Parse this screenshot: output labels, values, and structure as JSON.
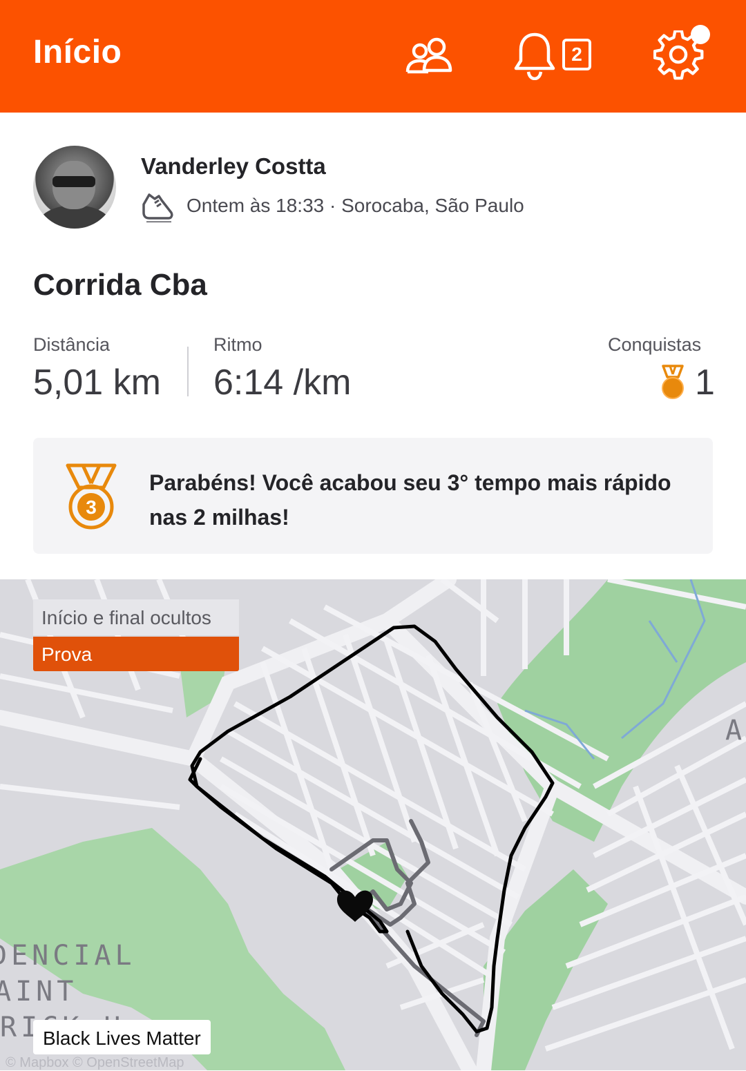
{
  "header": {
    "title": "Início",
    "notification_count": "2",
    "accent_color": "#fc5200",
    "icons": [
      "people-icon",
      "bell-icon",
      "gear-icon"
    ]
  },
  "activity": {
    "athlete_name": "Vanderley Costta",
    "sport_icon": "running-shoe-icon",
    "meta": "Ontem às 18:33 · Sorocaba, São Paulo",
    "title": "Corrida Cba",
    "stats": {
      "distance_label": "Distância",
      "distance_value": "5,01 km",
      "pace_label": "Ritmo",
      "pace_value": "6:14 /km",
      "achievements_label": "Conquistas",
      "achievements_value": "1"
    },
    "achievement_message": "Parabéns! Você acabou seu 3° tempo mais rápido nas 2 milhas!",
    "medal_number": "3",
    "medal_color": "#e8890c"
  },
  "map": {
    "tag_hidden": "Início e final ocultos",
    "tag_race": "Prova",
    "badge": "Black Lives Matter",
    "attribution": "© Mapbox © OpenStreetMap",
    "place_labels": [
      "DENCIAL",
      "AINT",
      "RICK H",
      "A"
    ],
    "route_color": "#000000",
    "park_color": "#9fd1a0"
  }
}
